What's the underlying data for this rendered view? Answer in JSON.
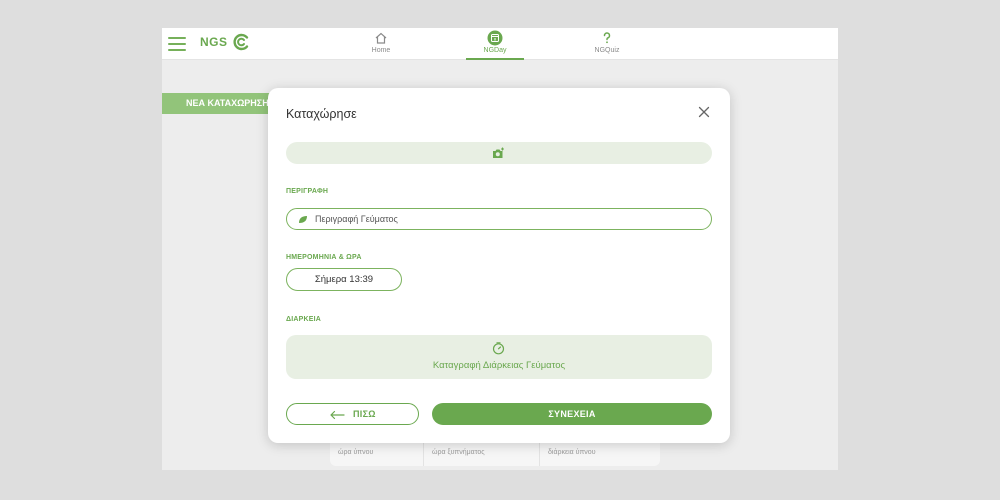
{
  "header": {
    "brand": "NGS",
    "nav": [
      {
        "label": "Home",
        "icon": "home-icon"
      },
      {
        "label": "NGDay",
        "icon": "calendar-icon"
      },
      {
        "label": "NGQuiz",
        "icon": "question-icon"
      }
    ],
    "active_tab": "NGDay"
  },
  "background": {
    "new_entry_label": "ΝΕΑ ΚΑΤΑΧΩΡΗΣΗ",
    "summary_columns": [
      "ώρα ύπνου",
      "ώρα ξυπνήματος",
      "διάρκεια ύπνου"
    ]
  },
  "modal": {
    "title": "Καταχώρησε",
    "photo_icon": "camera-plus-icon",
    "description_label": "ΠΕΡΙΓΡΑΦΗ",
    "description_placeholder": "Περιγραφή Γεύματος",
    "datetime_label": "ΗΜΕΡΟΜΗΝΙΑ & ΩΡΑ",
    "datetime_value": "Σήμερα 13:39",
    "duration_label": "ΔΙΑΡΚΕΙΑ",
    "duration_button": "Καταγραφή Διάρκειας Γεύματος",
    "back_label": "ΠΙΣΩ",
    "continue_label": "ΣΥΝΕΧΕΙΑ"
  },
  "colors": {
    "accent": "#6aa84f",
    "accent_light": "#e8efe3",
    "sidebar_button": "#92c47a"
  }
}
